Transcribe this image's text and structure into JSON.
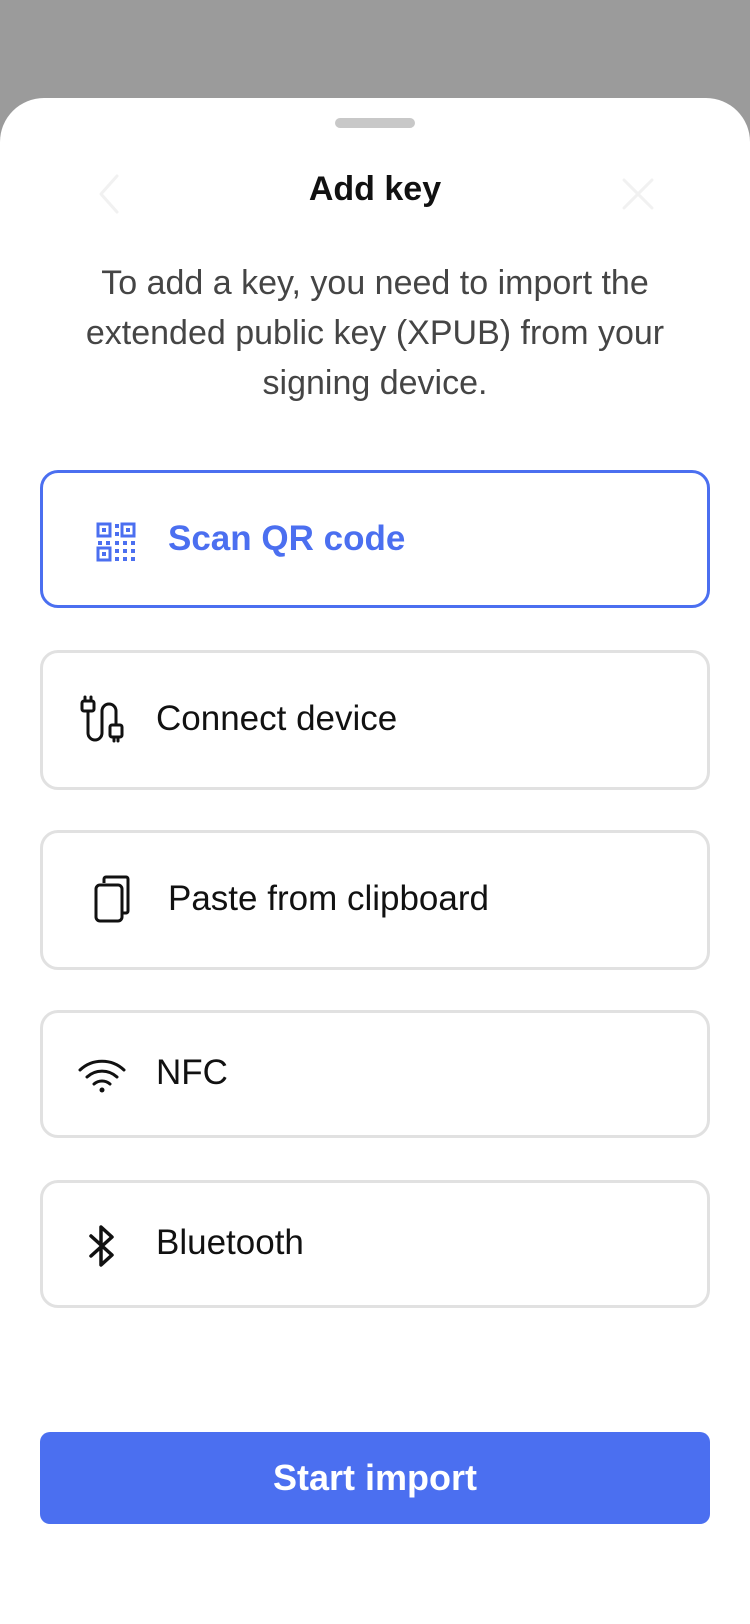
{
  "sheet": {
    "title": "Add key",
    "subtitle": "To add a key, you need to import the extended public key (XPUB) from your signing device."
  },
  "options": [
    {
      "label": "Scan QR code",
      "icon": "qr-code-icon",
      "selected": true
    },
    {
      "label": "Connect device",
      "icon": "usb-cable-icon",
      "selected": false
    },
    {
      "label": "Paste from clipboard",
      "icon": "clipboard-icon",
      "selected": false
    },
    {
      "label": "NFC",
      "icon": "wifi-icon",
      "selected": false
    },
    {
      "label": "Bluetooth",
      "icon": "bluetooth-icon",
      "selected": false
    }
  ],
  "primary_button": {
    "label": "Start import"
  },
  "colors": {
    "accent": "#4b6ff0",
    "backdrop": "#9b9b9b",
    "border": "#e1e1e1"
  }
}
